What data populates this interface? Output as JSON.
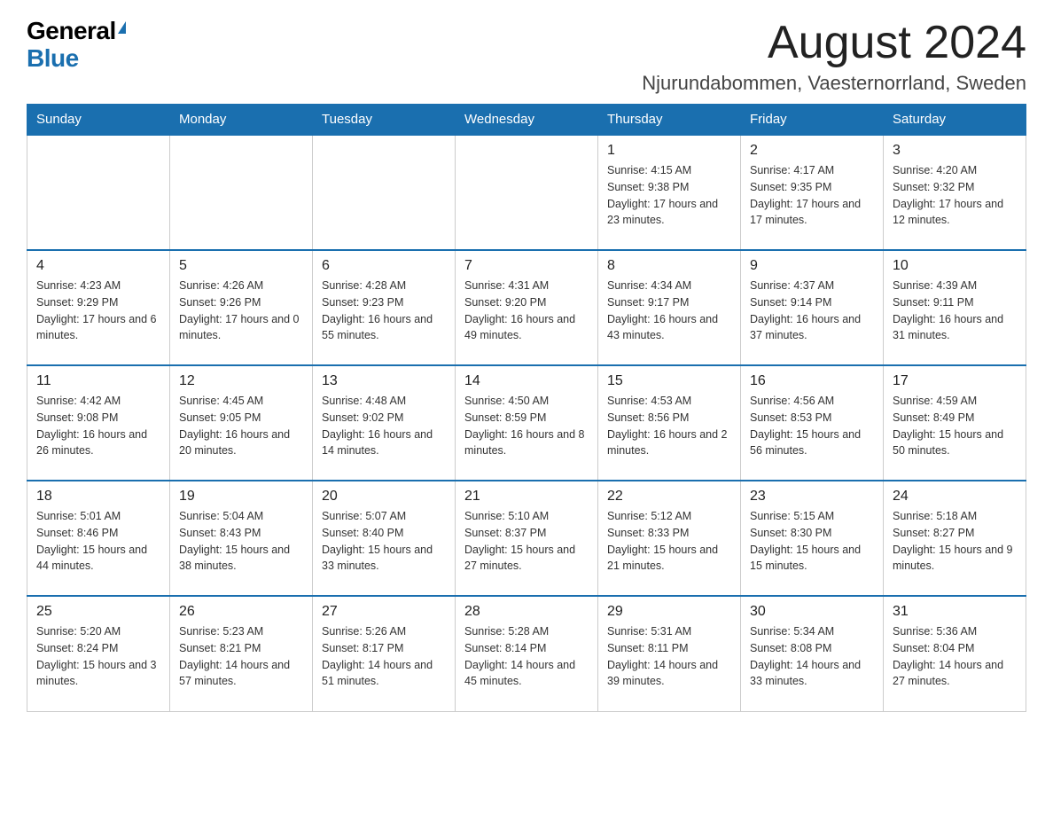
{
  "logo": {
    "general": "General",
    "blue": "Blue"
  },
  "title": "August 2024",
  "location": "Njurundabommen, Vaesternorrland, Sweden",
  "days_of_week": [
    "Sunday",
    "Monday",
    "Tuesday",
    "Wednesday",
    "Thursday",
    "Friday",
    "Saturday"
  ],
  "weeks": [
    [
      {
        "day": "",
        "info": ""
      },
      {
        "day": "",
        "info": ""
      },
      {
        "day": "",
        "info": ""
      },
      {
        "day": "",
        "info": ""
      },
      {
        "day": "1",
        "sunrise": "4:15 AM",
        "sunset": "9:38 PM",
        "daylight": "17 hours and 23 minutes."
      },
      {
        "day": "2",
        "sunrise": "4:17 AM",
        "sunset": "9:35 PM",
        "daylight": "17 hours and 17 minutes."
      },
      {
        "day": "3",
        "sunrise": "4:20 AM",
        "sunset": "9:32 PM",
        "daylight": "17 hours and 12 minutes."
      }
    ],
    [
      {
        "day": "4",
        "sunrise": "4:23 AM",
        "sunset": "9:29 PM",
        "daylight": "17 hours and 6 minutes."
      },
      {
        "day": "5",
        "sunrise": "4:26 AM",
        "sunset": "9:26 PM",
        "daylight": "17 hours and 0 minutes."
      },
      {
        "day": "6",
        "sunrise": "4:28 AM",
        "sunset": "9:23 PM",
        "daylight": "16 hours and 55 minutes."
      },
      {
        "day": "7",
        "sunrise": "4:31 AM",
        "sunset": "9:20 PM",
        "daylight": "16 hours and 49 minutes."
      },
      {
        "day": "8",
        "sunrise": "4:34 AM",
        "sunset": "9:17 PM",
        "daylight": "16 hours and 43 minutes."
      },
      {
        "day": "9",
        "sunrise": "4:37 AM",
        "sunset": "9:14 PM",
        "daylight": "16 hours and 37 minutes."
      },
      {
        "day": "10",
        "sunrise": "4:39 AM",
        "sunset": "9:11 PM",
        "daylight": "16 hours and 31 minutes."
      }
    ],
    [
      {
        "day": "11",
        "sunrise": "4:42 AM",
        "sunset": "9:08 PM",
        "daylight": "16 hours and 26 minutes."
      },
      {
        "day": "12",
        "sunrise": "4:45 AM",
        "sunset": "9:05 PM",
        "daylight": "16 hours and 20 minutes."
      },
      {
        "day": "13",
        "sunrise": "4:48 AM",
        "sunset": "9:02 PM",
        "daylight": "16 hours and 14 minutes."
      },
      {
        "day": "14",
        "sunrise": "4:50 AM",
        "sunset": "8:59 PM",
        "daylight": "16 hours and 8 minutes."
      },
      {
        "day": "15",
        "sunrise": "4:53 AM",
        "sunset": "8:56 PM",
        "daylight": "16 hours and 2 minutes."
      },
      {
        "day": "16",
        "sunrise": "4:56 AM",
        "sunset": "8:53 PM",
        "daylight": "15 hours and 56 minutes."
      },
      {
        "day": "17",
        "sunrise": "4:59 AM",
        "sunset": "8:49 PM",
        "daylight": "15 hours and 50 minutes."
      }
    ],
    [
      {
        "day": "18",
        "sunrise": "5:01 AM",
        "sunset": "8:46 PM",
        "daylight": "15 hours and 44 minutes."
      },
      {
        "day": "19",
        "sunrise": "5:04 AM",
        "sunset": "8:43 PM",
        "daylight": "15 hours and 38 minutes."
      },
      {
        "day": "20",
        "sunrise": "5:07 AM",
        "sunset": "8:40 PM",
        "daylight": "15 hours and 33 minutes."
      },
      {
        "day": "21",
        "sunrise": "5:10 AM",
        "sunset": "8:37 PM",
        "daylight": "15 hours and 27 minutes."
      },
      {
        "day": "22",
        "sunrise": "5:12 AM",
        "sunset": "8:33 PM",
        "daylight": "15 hours and 21 minutes."
      },
      {
        "day": "23",
        "sunrise": "5:15 AM",
        "sunset": "8:30 PM",
        "daylight": "15 hours and 15 minutes."
      },
      {
        "day": "24",
        "sunrise": "5:18 AM",
        "sunset": "8:27 PM",
        "daylight": "15 hours and 9 minutes."
      }
    ],
    [
      {
        "day": "25",
        "sunrise": "5:20 AM",
        "sunset": "8:24 PM",
        "daylight": "15 hours and 3 minutes."
      },
      {
        "day": "26",
        "sunrise": "5:23 AM",
        "sunset": "8:21 PM",
        "daylight": "14 hours and 57 minutes."
      },
      {
        "day": "27",
        "sunrise": "5:26 AM",
        "sunset": "8:17 PM",
        "daylight": "14 hours and 51 minutes."
      },
      {
        "day": "28",
        "sunrise": "5:28 AM",
        "sunset": "8:14 PM",
        "daylight": "14 hours and 45 minutes."
      },
      {
        "day": "29",
        "sunrise": "5:31 AM",
        "sunset": "8:11 PM",
        "daylight": "14 hours and 39 minutes."
      },
      {
        "day": "30",
        "sunrise": "5:34 AM",
        "sunset": "8:08 PM",
        "daylight": "14 hours and 33 minutes."
      },
      {
        "day": "31",
        "sunrise": "5:36 AM",
        "sunset": "8:04 PM",
        "daylight": "14 hours and 27 minutes."
      }
    ]
  ]
}
